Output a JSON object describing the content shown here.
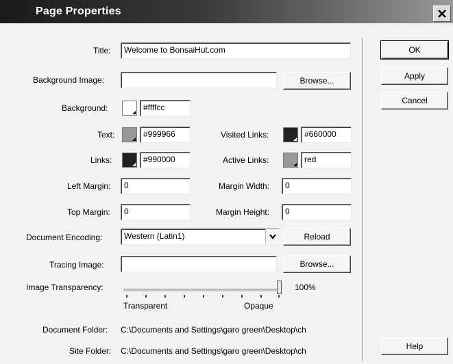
{
  "dialog": {
    "title": "Page Properties"
  },
  "fields": {
    "title_label": "Title:",
    "title_value": "Welcome to BonsaiHut.com",
    "bg_image_label": "Background Image:",
    "bg_image_value": "",
    "browse_label": "Browse...",
    "background_label": "Background:",
    "background_value": "#ffffcc",
    "text_label": "Text:",
    "text_value": "#999966",
    "visited_label": "Visited Links:",
    "visited_value": "#660000",
    "links_label": "Links:",
    "links_value": "#990000",
    "active_label": "Active Links:",
    "active_value": "red",
    "left_margin_label": "Left Margin:",
    "left_margin_value": "0",
    "margin_width_label": "Margin Width:",
    "margin_width_value": "0",
    "top_margin_label": "Top Margin:",
    "top_margin_value": "0",
    "margin_height_label": "Margin Height:",
    "margin_height_value": "0",
    "encoding_label": "Document Encoding:",
    "encoding_value": "Western (Latin1)",
    "reload_label": "Reload",
    "tracing_label": "Tracing Image:",
    "tracing_value": "",
    "browse2_label": "Browse...",
    "transparency_label": "Image Transparency:",
    "transparency_percent": "100%",
    "transparent_label": "Transparent",
    "opaque_label": "Opaque",
    "doc_folder_label": "Document Folder:",
    "doc_folder_value": "C:\\Documents and Settings\\garo green\\Desktop\\ch",
    "site_folder_label": "Site Folder:",
    "site_folder_value": "C:\\Documents and Settings\\garo green\\Desktop\\ch"
  },
  "buttons": {
    "ok": "OK",
    "apply": "Apply",
    "cancel": "Cancel",
    "help": "Help"
  },
  "colors": {
    "background_swatch": "#ffffff",
    "text_swatch": "#999999",
    "visited_swatch": "#222222",
    "links_swatch": "#222222",
    "active_swatch": "#999999"
  },
  "slider": {
    "value_fraction": 1.0
  }
}
